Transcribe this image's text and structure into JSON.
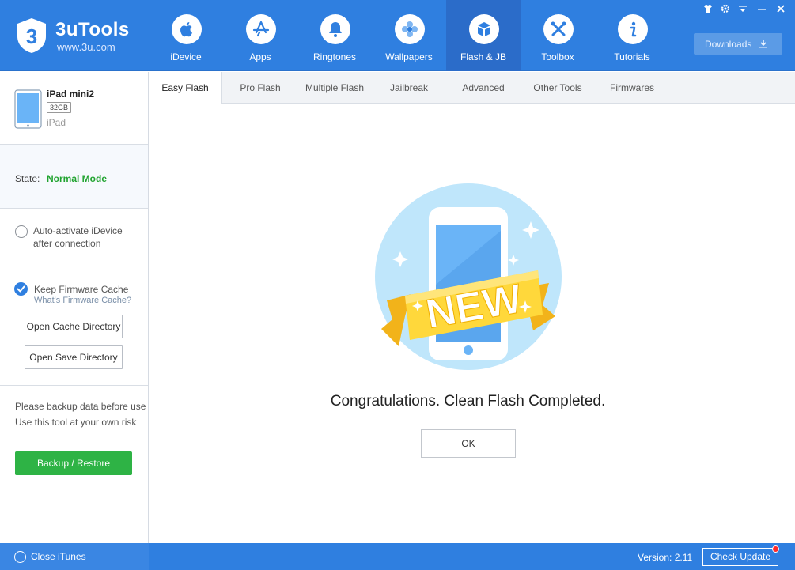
{
  "app": {
    "name": "3uTools",
    "url": "www.3u.com"
  },
  "nav": {
    "items": [
      {
        "label": "iDevice",
        "icon": "apple-icon"
      },
      {
        "label": "Apps",
        "icon": "app-store-icon"
      },
      {
        "label": "Ringtones",
        "icon": "bell-icon"
      },
      {
        "label": "Wallpapers",
        "icon": "flower-icon"
      },
      {
        "label": "Flash & JB",
        "icon": "box-icon",
        "active": true
      },
      {
        "label": "Toolbox",
        "icon": "tools-icon"
      },
      {
        "label": "Tutorials",
        "icon": "info-icon"
      }
    ],
    "downloads_label": "Downloads"
  },
  "device": {
    "name": "iPad mini2",
    "capacity": "32GB",
    "type": "iPad"
  },
  "state": {
    "label": "State:",
    "value": "Normal Mode"
  },
  "options": {
    "auto_activate_line1": "Auto-activate iDevice",
    "auto_activate_line2": "after connection",
    "auto_activate_checked": false,
    "keep_cache_label": "Keep Firmware Cache",
    "keep_cache_checked": true,
    "cache_link": "What's Firmware Cache?",
    "open_cache_button": "Open Cache Directory",
    "open_save_button": "Open Save Directory"
  },
  "notice": {
    "line1": "Please backup data before use",
    "line2": "Use this tool at your own risk",
    "backup_button": "Backup / Restore"
  },
  "tabs": [
    {
      "label": "Easy Flash",
      "active": true
    },
    {
      "label": "Pro Flash"
    },
    {
      "label": "Multiple Flash"
    },
    {
      "label": "Jailbreak"
    },
    {
      "label": "Advanced"
    },
    {
      "label": "Other Tools"
    },
    {
      "label": "Firmwares"
    }
  ],
  "main": {
    "badge_text": "NEW",
    "message": "Congratulations. Clean Flash Completed.",
    "ok_label": "OK"
  },
  "footer": {
    "close_itunes": "Close iTunes",
    "version": "Version: 2.11",
    "check_update": "Check Update"
  },
  "colors": {
    "brand_blue": "#2f7fe0",
    "success_green": "#20a32f",
    "button_green": "#2eb345",
    "notification_red": "#ff2a2a"
  }
}
